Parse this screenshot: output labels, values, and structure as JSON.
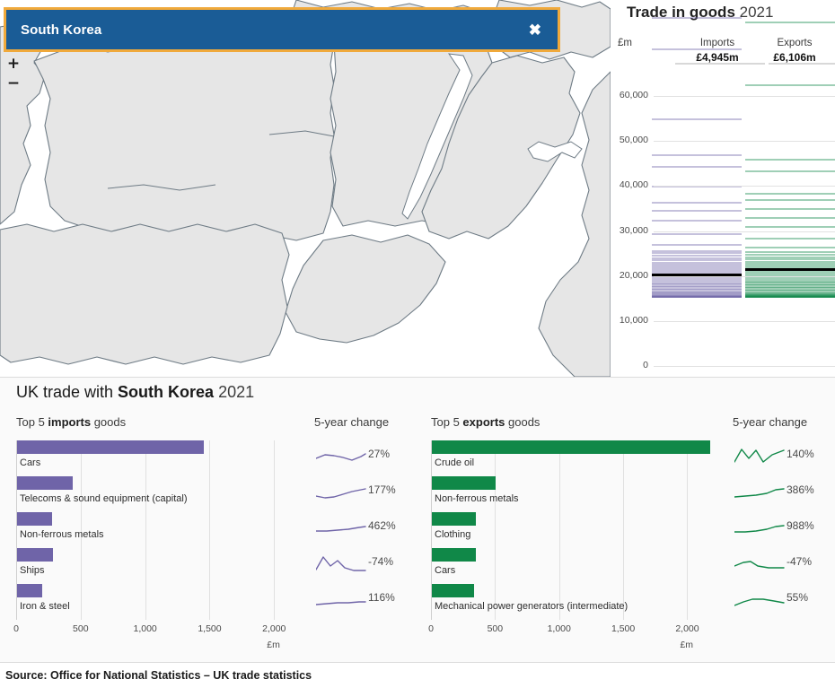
{
  "map": {
    "country_banner": {
      "name": "South Korea",
      "close_label": "✖"
    },
    "zoom_in_label": "+",
    "zoom_out_label": "−"
  },
  "strip": {
    "title_main": "Trade in goods",
    "title_year": "2021",
    "unit_label": "£m",
    "imports_label": "Imports",
    "imports_value": "£4,945m",
    "exports_label": "Exports",
    "exports_value": "£6,106m",
    "y_ticks": [
      "60,000",
      "50,000",
      "40,000",
      "30,000",
      "20,000",
      "10,000",
      "0"
    ]
  },
  "bottom": {
    "title_prefix": "UK trade with ",
    "title_country": "South Korea",
    "title_year": "2021",
    "imports_sub_pre": "Top 5 ",
    "imports_sub_bold": "imports",
    "imports_sub_post": " goods",
    "exports_sub_pre": "Top 5 ",
    "exports_sub_bold": "exports",
    "exports_sub_post": " goods",
    "change_header_left": "5-year change",
    "change_header_right": "5-year change",
    "axis_unit_left": "£m",
    "axis_unit_right": "£m"
  },
  "source": {
    "text": "Source: Office for National Statistics – UK trade statistics"
  },
  "colors": {
    "imports": "#6f64a8",
    "exports": "#108848",
    "banner_blue": "#1a5c96",
    "banner_border": "#f0a93b",
    "selected_marker": "#000000"
  },
  "chart_data": [
    {
      "type": "bar",
      "title": "Top 5 imports goods",
      "orientation": "horizontal",
      "categories": [
        "Cars",
        "Telecoms & sound equipment (capital)",
        "Non-ferrous metals",
        "Ships",
        "Iron & steel"
      ],
      "values": [
        1450,
        430,
        272,
        275,
        196
      ],
      "xlabel": "£m",
      "ylabel": "",
      "xlim": [
        0,
        2200
      ],
      "x_ticks": [
        "0",
        "500",
        "1,000",
        "1,500",
        "2,000"
      ],
      "x_tick_values": [
        0,
        500,
        1000,
        1500,
        2000
      ],
      "grid": true,
      "color": "#6f64a8",
      "annotations": {
        "five_year_change": [
          "27%",
          "177%",
          "462%",
          "-74%",
          "116%"
        ]
      }
    },
    {
      "type": "bar",
      "title": "Top 5 exports goods",
      "orientation": "horizontal",
      "categories": [
        "Crude oil",
        "Non-ferrous metals",
        "Clothing",
        "Cars",
        "Mechanical power generators (intermediate)"
      ],
      "values": [
        2170,
        495,
        345,
        340,
        330
      ],
      "xlabel": "£m",
      "ylabel": "",
      "xlim": [
        0,
        2200
      ],
      "x_ticks": [
        "0",
        "500",
        "1,000",
        "1,500",
        "2,000"
      ],
      "x_tick_values": [
        0,
        500,
        1000,
        1500,
        2000
      ],
      "grid": true,
      "color": "#108848",
      "annotations": {
        "five_year_change": [
          "140%",
          "386%",
          "988%",
          "-47%",
          "55%"
        ]
      }
    },
    {
      "type": "strip",
      "title": "Trade in goods 2021",
      "ylabel": "£m",
      "ylim": [
        0,
        63000
      ],
      "y_ticks": [
        0,
        10000,
        20000,
        30000,
        40000,
        50000,
        60000
      ],
      "y_tick_labels": [
        "0",
        "10,000",
        "20,000",
        "30,000",
        "40,000",
        "50,000",
        "60,000"
      ],
      "grid": true,
      "series": [
        {
          "name": "Imports",
          "color": "#6f64a8",
          "selected_label": "South Korea",
          "selected_value": 4945,
          "values": [
            62000,
            55000,
            39500,
            31500,
            29000,
            24500,
            21000,
            19200,
            17000,
            14000,
            11500,
            10200,
            9800,
            9200,
            8600,
            8100,
            7600,
            7200,
            6800,
            6400,
            6000,
            5600,
            5200,
            4945,
            4500,
            4100,
            3700,
            3300,
            3000,
            2700,
            2400,
            2100,
            1800,
            1500,
            1200,
            900,
            700,
            500,
            350,
            250,
            150,
            80,
            40,
            20,
            10
          ]
        },
        {
          "name": "Exports",
          "color": "#108848",
          "selected_label": "South Korea",
          "selected_value": 6106,
          "values": [
            61000,
            47000,
            30500,
            28000,
            23000,
            21500,
            19500,
            17500,
            15500,
            13000,
            11000,
            10000,
            9400,
            8800,
            8300,
            7800,
            7300,
            6900,
            6500,
            6106,
            5800,
            5400,
            5000,
            4600,
            4200,
            3800,
            3400,
            3100,
            2800,
            2500,
            2200,
            1900,
            1600,
            1300,
            1000,
            800,
            600,
            420,
            300,
            200,
            120,
            70,
            35,
            18,
            8
          ]
        }
      ]
    }
  ]
}
